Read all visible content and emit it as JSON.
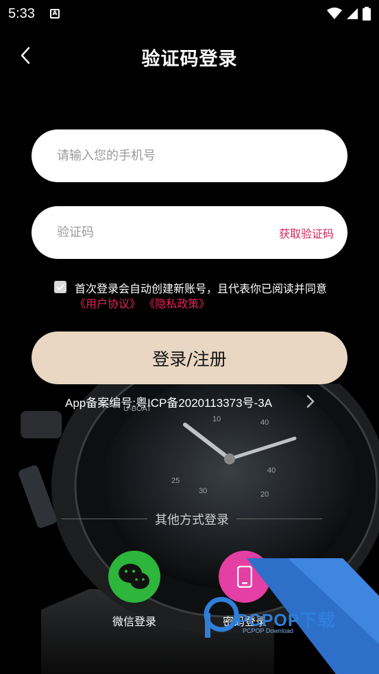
{
  "status_bar": {
    "time": "5:33",
    "notification_glyph": "A"
  },
  "header": {
    "title": "验证码登录"
  },
  "phone_field": {
    "placeholder": "请输入您的手机号",
    "value": ""
  },
  "code_field": {
    "placeholder": "验证码",
    "value": "",
    "get_code_label": "获取验证码"
  },
  "agreement": {
    "checked": true,
    "text": "首次登录会自动创建新账号，且代表你已阅读并同意",
    "user_agreement": "《用户协议》",
    "privacy_policy": "《隐私政策》"
  },
  "login_button": {
    "label": "登录/注册"
  },
  "icp": {
    "text": "App备案编号:粤ICP备2020113373号-3A"
  },
  "other_login": {
    "title": "其他方式登录",
    "options": [
      {
        "label": "微信登录",
        "icon": "wechat-icon",
        "color": "#2db53c"
      },
      {
        "label": "密码登录",
        "icon": "phone-icon",
        "color": "#e43fa4"
      }
    ]
  },
  "watermark": {
    "text": "PCPOP下载",
    "sub": "PCPOP Download"
  },
  "colors": {
    "accent": "#e8235b",
    "button": "#e9d7c3",
    "background": "#000000"
  }
}
